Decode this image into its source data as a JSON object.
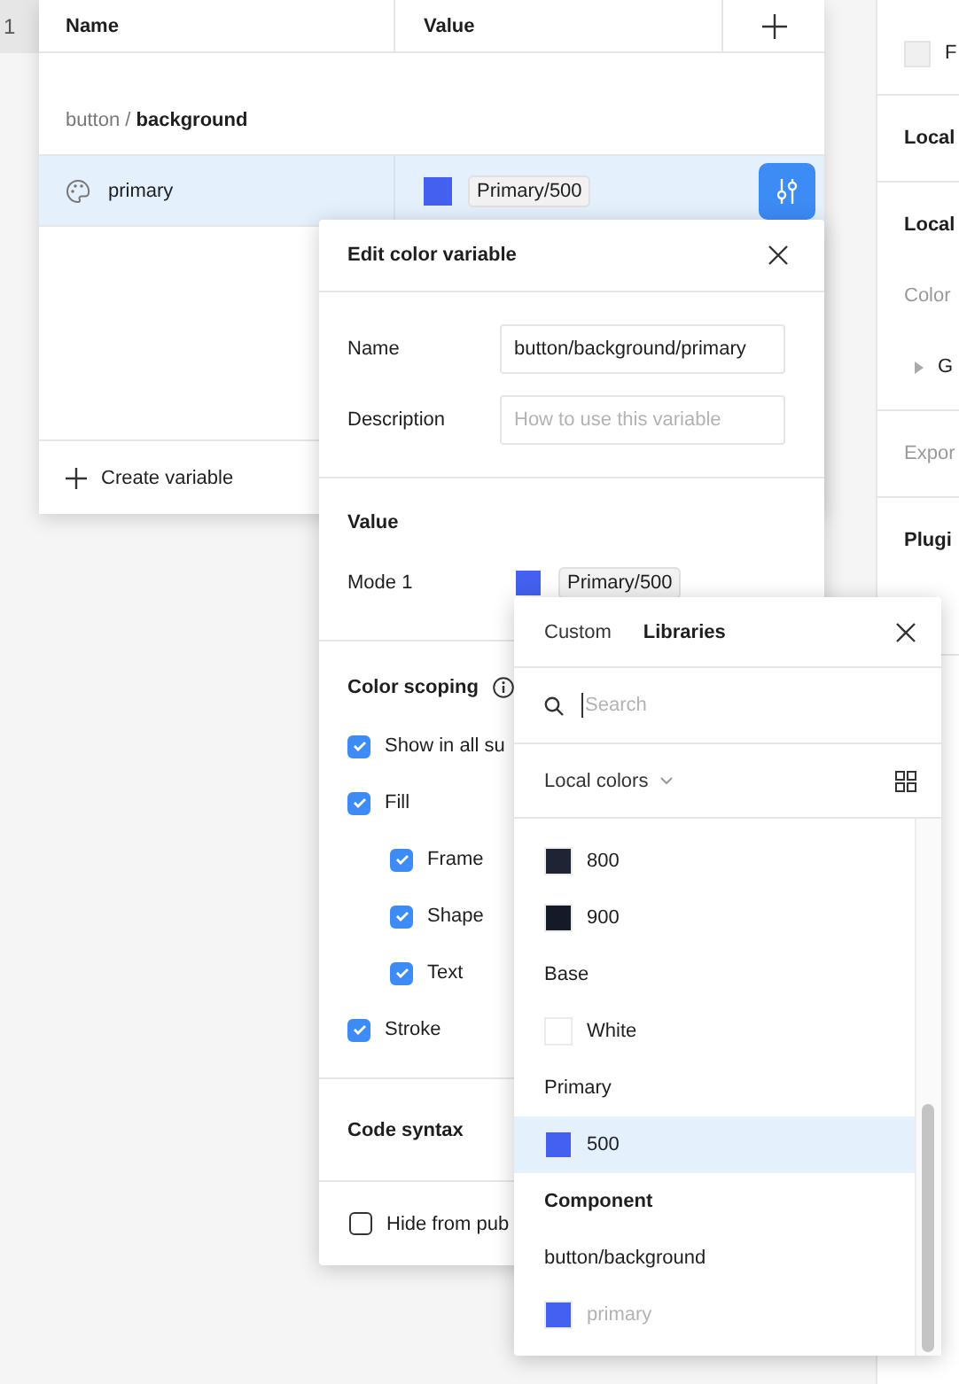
{
  "row_numbers": [
    "1"
  ],
  "variables_table": {
    "columns": [
      "Name",
      "Value"
    ],
    "group_path": "button / **background**",
    "rows": [
      {
        "name": "primary",
        "color": "#4361ee",
        "value": "Primary/500",
        "selected": true
      }
    ],
    "create_label": "Create variable"
  },
  "right_panel": {
    "sections": [
      [
        {
          "kind": "swatch",
          "label": "F"
        }
      ],
      [
        {
          "kind": "heading",
          "label": "Local"
        }
      ],
      [
        {
          "kind": "heading",
          "label": "Local"
        },
        {
          "kind": "muted",
          "label": "Color"
        },
        {
          "kind": "tree",
          "label": "G"
        }
      ],
      [
        {
          "kind": "muted",
          "label": "Expor"
        }
      ],
      [
        {
          "kind": "heading",
          "label": "Plugi"
        },
        {
          "kind": "plugin"
        }
      ]
    ]
  },
  "edit_dialog": {
    "title": "Edit color variable",
    "fields": [
      {
        "label": "Name",
        "value": "button/background/primary"
      },
      {
        "label": "Description",
        "placeholder": "How to use this variable"
      }
    ],
    "value_title": "Value",
    "modes": [
      {
        "label": "Mode 1",
        "color": "#4361ee",
        "value": "Primary/500"
      }
    ],
    "scoping_title": "Color scoping",
    "scopes": [
      {
        "label": "Show in all su",
        "checked": true
      },
      {
        "label": "Fill",
        "checked": true,
        "children": [
          {
            "label": "Frame",
            "checked": true
          },
          {
            "label": "Shape",
            "checked": true
          },
          {
            "label": "Text",
            "checked": true
          }
        ]
      },
      {
        "label": "Stroke",
        "checked": true
      }
    ],
    "code_syntax_title": "Code syntax",
    "hide_option": {
      "label": "Hide from pub",
      "checked": false
    }
  },
  "color_picker": {
    "tabs": [
      {
        "label": "Custom",
        "selected": false
      },
      {
        "label": "Libraries",
        "selected": true
      }
    ],
    "search": {
      "placeholder": "Search"
    },
    "source": "Local colors",
    "items": [
      {
        "kind": "swatch",
        "label": "800",
        "color": "#1e2433",
        "selected": false,
        "disabled": false
      },
      {
        "kind": "swatch",
        "label": "900",
        "color": "#141a27",
        "selected": false,
        "disabled": false
      },
      {
        "kind": "header",
        "label": "Base"
      },
      {
        "kind": "swatch",
        "label": "White",
        "color": "#ffffff",
        "selected": false,
        "disabled": false
      },
      {
        "kind": "header",
        "label": "Primary"
      },
      {
        "kind": "swatch",
        "label": "500",
        "color": "#4361ee",
        "selected": true,
        "disabled": false
      },
      {
        "kind": "section",
        "label": "Component"
      },
      {
        "kind": "header",
        "label": "button/background"
      },
      {
        "kind": "swatch",
        "label": "primary",
        "color": "#4361ee",
        "selected": false,
        "disabled": true
      }
    ]
  }
}
